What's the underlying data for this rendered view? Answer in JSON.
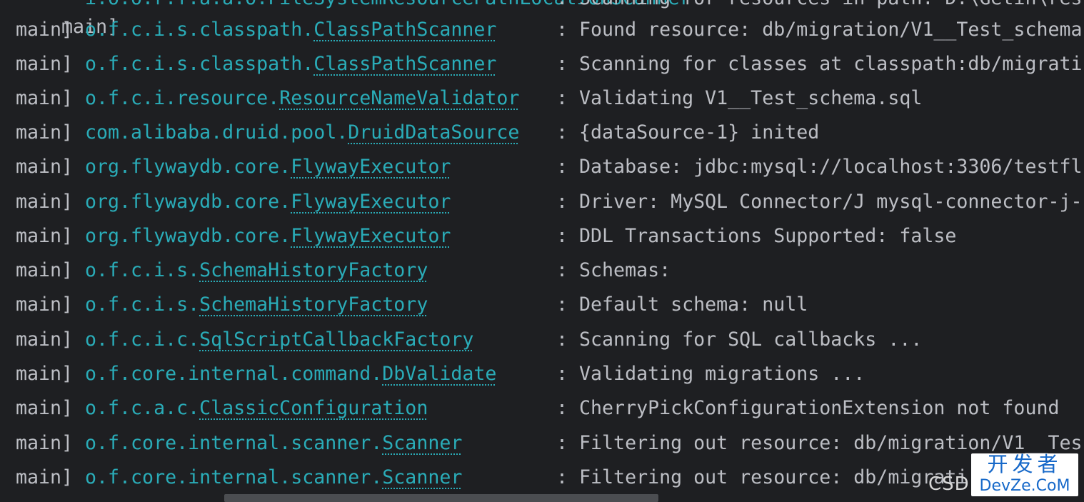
{
  "console": {
    "top_partial_line": {
      "thread": "main]",
      "logger": "i.o.o.r.f.a.a.o.FileSystemResourcePathLocationScanner",
      "message": ": Scanning for resources in path: D:\\Getin\\res"
    },
    "lines": [
      {
        "thread": "main]",
        "logger_pkg": "o.f.c.i.s.classpath.",
        "logger_cls": "ClassPathScanner",
        "message": ": Found resource: db/migration/V1__Test_schema"
      },
      {
        "thread": "main]",
        "logger_pkg": "o.f.c.i.s.classpath.",
        "logger_cls": "ClassPathScanner",
        "message": ": Scanning for classes at classpath:db/migrati"
      },
      {
        "thread": "main]",
        "logger_pkg": "o.f.c.i.resource.",
        "logger_cls": "ResourceNameValidator",
        "message": ": Validating V1__Test_schema.sql"
      },
      {
        "thread": "main]",
        "logger_pkg": "com.alibaba.druid.pool.",
        "logger_cls": "DruidDataSource",
        "message": ": {dataSource-1} inited"
      },
      {
        "thread": "main]",
        "logger_pkg": "org.flywaydb.core.",
        "logger_cls": "FlywayExecutor",
        "message": ": Database: jdbc:mysql://localhost:3306/testfl"
      },
      {
        "thread": "main]",
        "logger_pkg": "org.flywaydb.core.",
        "logger_cls": "FlywayExecutor",
        "message": ": Driver: MySQL Connector/J mysql-connector-j-"
      },
      {
        "thread": "main]",
        "logger_pkg": "org.flywaydb.core.",
        "logger_cls": "FlywayExecutor",
        "message": ": DDL Transactions Supported: false"
      },
      {
        "thread": "main]",
        "logger_pkg": "o.f.c.i.s.",
        "logger_cls": "SchemaHistoryFactory",
        "message": ": Schemas:"
      },
      {
        "thread": "main]",
        "logger_pkg": "o.f.c.i.s.",
        "logger_cls": "SchemaHistoryFactory",
        "message": ": Default schema: null"
      },
      {
        "thread": "main]",
        "logger_pkg": "o.f.c.i.c.",
        "logger_cls": "SqlScriptCallbackFactory",
        "message": ": Scanning for SQL callbacks ..."
      },
      {
        "thread": "main]",
        "logger_pkg": "o.f.core.internal.command.",
        "logger_cls": "DbValidate",
        "message": ": Validating migrations ..."
      },
      {
        "thread": "main]",
        "logger_pkg": "o.f.c.a.c.",
        "logger_cls": "ClassicConfiguration",
        "message": ": CherryPickConfigurationExtension not found"
      },
      {
        "thread": "main]",
        "logger_pkg": "o.f.core.internal.scanner.",
        "logger_cls": "Scanner",
        "message": ": Filtering out resource: db/migration/V1__Tes"
      },
      {
        "thread": "main]",
        "logger_pkg": "o.f.core.internal.scanner.",
        "logger_cls": "Scanner",
        "message": ": Filtering out resource: db/migrati"
      }
    ]
  },
  "watermark": {
    "prefix": "CSD",
    "cn": "开发者",
    "en": "DevZe.CoM"
  },
  "colors": {
    "background": "#1e1f22",
    "text": "#bcbec4",
    "logger": "#2aacb8",
    "scrollbar": "#4b4d51",
    "watermark": "#1769c9"
  }
}
